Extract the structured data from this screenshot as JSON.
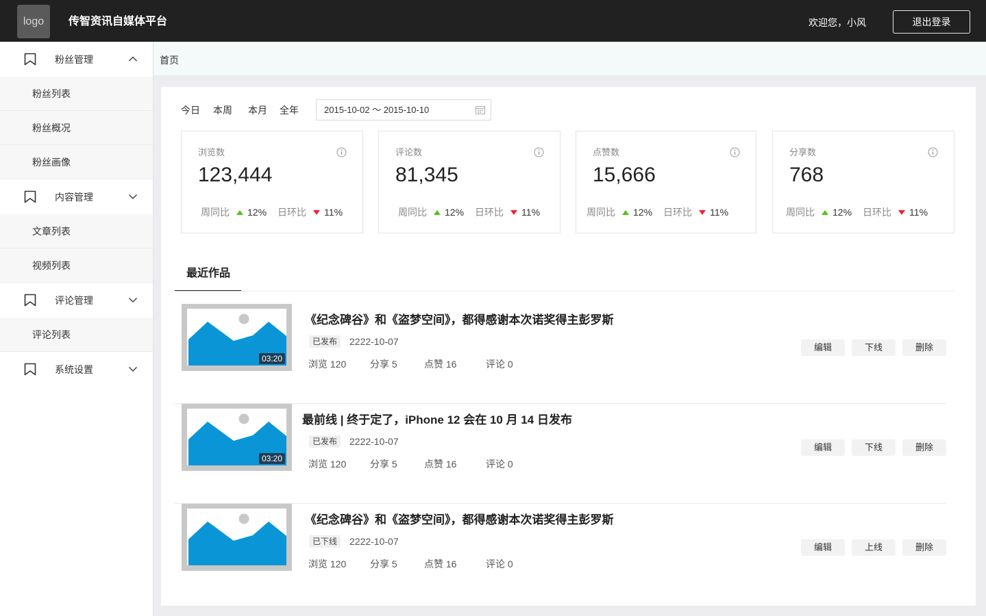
{
  "header": {
    "logo_text": "logo",
    "title": "传智资讯自媒体平台",
    "welcome": "欢迎您，小风",
    "logout_label": "退出登录"
  },
  "sidebar": {
    "groups": [
      {
        "label": "粉丝管理",
        "expanded": true,
        "items": [
          "粉丝列表",
          "粉丝概况",
          "粉丝画像"
        ]
      },
      {
        "label": "内容管理",
        "expanded": false,
        "items": [
          "文章列表",
          "视频列表"
        ]
      },
      {
        "label": "评论管理",
        "expanded": false,
        "items": [
          "评论列表"
        ]
      },
      {
        "label": "系统设置",
        "expanded": false,
        "items": []
      }
    ]
  },
  "breadcrumb": "首页",
  "date_filter": {
    "tabs": [
      "今日",
      "本周",
      "本月",
      "全年"
    ],
    "range": "2015-10-02 ～ 2015-10-10"
  },
  "stats": [
    {
      "label": "浏览数",
      "value": "123,444",
      "week_label": "周同比",
      "week_pct": "12%",
      "day_label": "日环比",
      "day_pct": "11%"
    },
    {
      "label": "评论数",
      "value": "81,345",
      "week_label": "周同比",
      "week_pct": "12%",
      "day_label": "日环比",
      "day_pct": "11%"
    },
    {
      "label": "点赞数",
      "value": "15,666",
      "week_label": "周同比",
      "week_pct": "12%",
      "day_label": "日环比",
      "day_pct": "11%"
    },
    {
      "label": "分享数",
      "value": "768",
      "week_label": "周同比",
      "week_pct": "12%",
      "day_label": "日环比",
      "day_pct": "11%"
    }
  ],
  "recent_works": {
    "tab_label": "最近作品",
    "items": [
      {
        "title": "《纪念碑谷》和《盗梦空间》，都得感谢本次诺奖得主彭罗斯",
        "status": "已发布",
        "date": "2222-10-07",
        "duration": "03:20",
        "views": "浏览 120",
        "shares": "分享 5",
        "likes": "点赞 16",
        "comments": "评论 0",
        "actions": [
          "编辑",
          "下线",
          "删除"
        ]
      },
      {
        "title": "最前线 | 终于定了，iPhone 12 会在 10 月 14 日发布",
        "status": "已发布",
        "date": "2222-10-07",
        "duration": "03:20",
        "views": "浏览 120",
        "shares": "分享 5",
        "likes": "点赞 16",
        "comments": "评论 0",
        "actions": [
          "编辑",
          "下线",
          "删除"
        ]
      },
      {
        "title": "《纪念碑谷》和《盗梦空间》，都得感谢本次诺奖得主彭罗斯",
        "status": "已下线",
        "date": "2222-10-07",
        "duration": "",
        "views": "浏览 120",
        "shares": "分享 5",
        "likes": "点赞 16",
        "comments": "评论 0",
        "actions": [
          "编辑",
          "上线",
          "删除"
        ]
      }
    ]
  },
  "colors": {
    "header_bg": "#212121",
    "thumb_blue": "#0a96d6",
    "trend_up": "#52c41a",
    "trend_down": "#f5222d"
  }
}
